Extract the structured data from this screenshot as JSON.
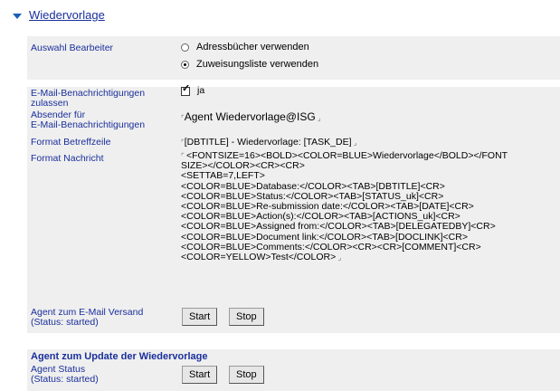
{
  "section": {
    "title": "Wiedervorlage"
  },
  "labels": {
    "auswahl": "Auswahl Bearbeiter",
    "email_line1": "E-Mail-Benachrichtigungen",
    "email_line2": "zulassen",
    "absender_line1": "Absender für",
    "absender_line2": "E-Mail-Benachrichtigungen",
    "betreff": "Format Betreffzeile",
    "nachricht": "Format Nachricht",
    "agent_email_line1": "Agent zum E-Mail Versand",
    "agent_email_line2": "(Status: started)"
  },
  "radio": {
    "option1": "Adressbücher verwenden",
    "option2": "Zuweisungsliste verwenden",
    "selected": 2
  },
  "checkbox": {
    "label": "ja",
    "checked": true
  },
  "absender": {
    "value": "Agent Wiedervorlage@ISG"
  },
  "betreff": {
    "value": "[DBTITLE] - Wiedervorlage: [TASK_DE]"
  },
  "nachricht": {
    "lines": [
      "<FONTSIZE=16><BOLD><COLOR=BLUE>Wiedervorlage</BOLD></FONT",
      "SIZE></COLOR><CR><CR>",
      "<SETTAB=7,LEFT>",
      "<COLOR=BLUE>Database:</COLOR><TAB>[DBTITLE]<CR>",
      "<COLOR=BLUE>Status:</COLOR><TAB>[STATUS_uk]<CR>",
      "<COLOR=BLUE>Re-submission date:</COLOR><TAB>[DATE]<CR>",
      "<COLOR=BLUE>Action(s):</COLOR><TAB>[ACTIONS_uk]<CR>",
      "<COLOR=BLUE>Assigned from:</COLOR><TAB>[DELEGATEDBY]<CR>",
      "<COLOR=BLUE>Document link:</COLOR><TAB>[DOCLINK]<CR>",
      "<COLOR=BLUE>Comments:</COLOR><CR><CR>[COMMENT]<CR>",
      "<COLOR=YELLOW>Test</COLOR>"
    ]
  },
  "buttons": {
    "start": "Start",
    "stop": "Stop"
  },
  "update_group": {
    "title": "Agent zum Update der Wiedervorlage",
    "label_line1": "Agent Status",
    "label_line2": "(Status: started)"
  }
}
